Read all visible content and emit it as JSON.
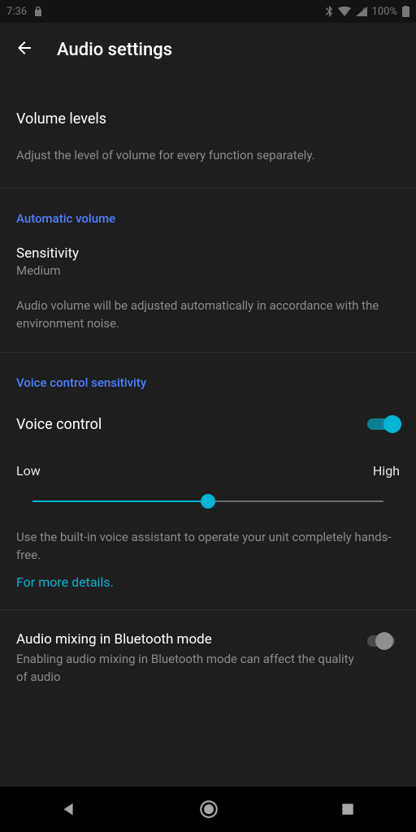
{
  "status": {
    "time": "7:36",
    "battery": "100%"
  },
  "header": {
    "title": "Audio settings"
  },
  "volume_levels": {
    "title": "Volume levels",
    "desc": "Adjust the level of volume for every function separately."
  },
  "automatic_volume": {
    "heading": "Automatic volume",
    "title": "Sensitivity",
    "value": "Medium",
    "desc": "Audio volume will be adjusted automatically in accordance with the environment noise."
  },
  "voice_control": {
    "heading": "Voice control sensitivity",
    "title": "Voice control",
    "enabled": true,
    "low_label": "Low",
    "high_label": "High",
    "slider_value": 50,
    "desc": "Use the built-in voice assistant to operate your unit completely hands-free.",
    "link": "For more details."
  },
  "bluetooth_mix": {
    "title": "Audio mixing in Bluetooth mode",
    "desc": "Enabling audio mixing in Bluetooth mode can affect the quality of audio",
    "enabled": false
  }
}
